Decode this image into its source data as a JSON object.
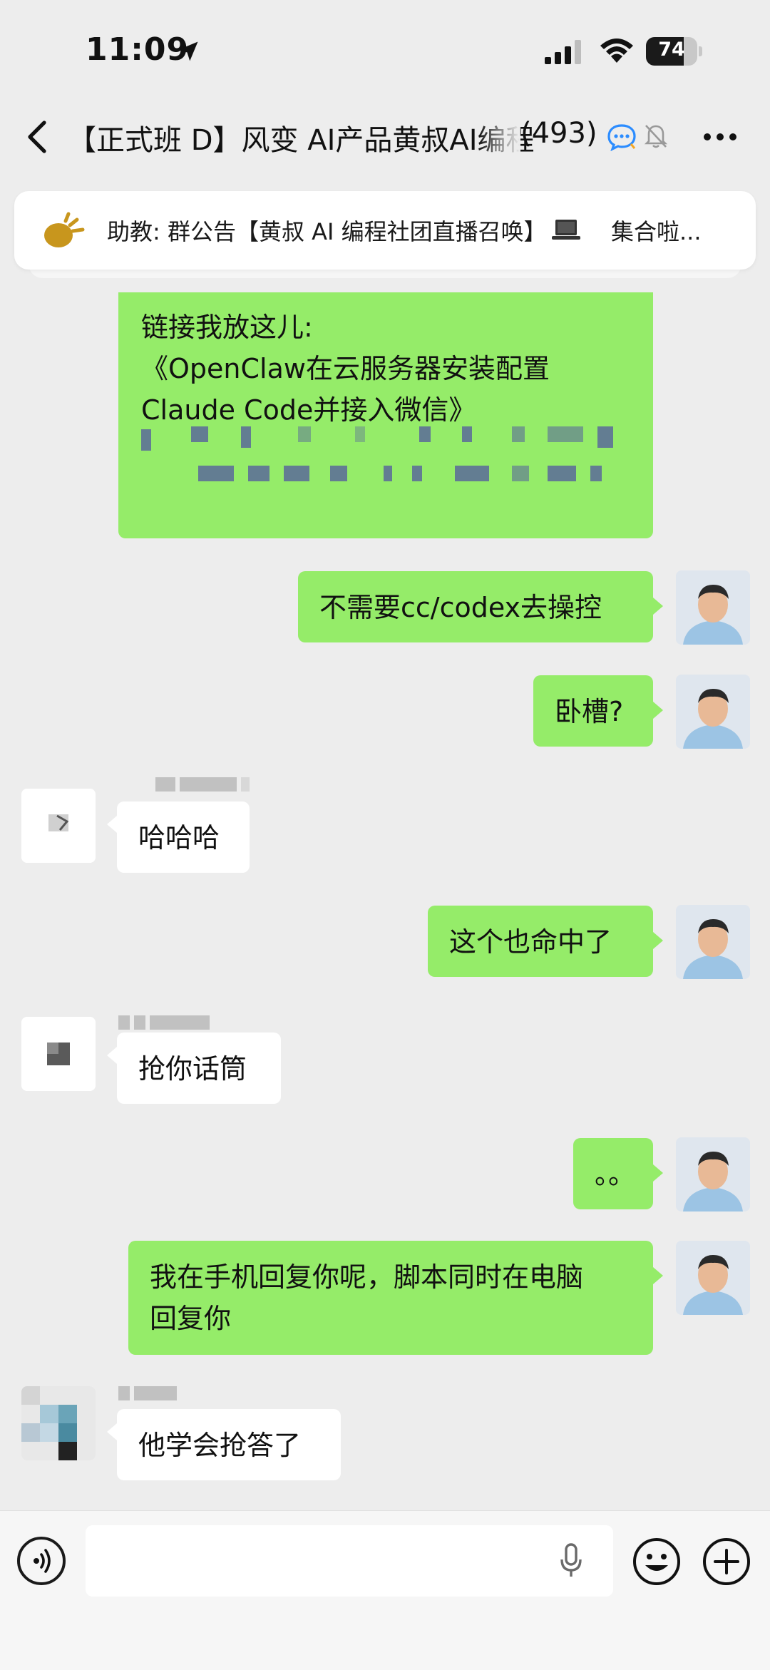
{
  "status_bar": {
    "time": "11:09",
    "battery_text": "74",
    "battery_level_percent": 74
  },
  "nav": {
    "title": "【正式班 D】风变 AI产品黄叔AI编程",
    "member_count": "(493)"
  },
  "announcement": {
    "prefix": "助教: 群公告【黄叔 AI 编程社团直播召唤】",
    "suffix": "集合啦..."
  },
  "messages": [
    {
      "sender": "me",
      "lines": [
        "链接我放这儿:",
        "《OpenClaw在云服务器安装配置",
        "Claude Code并接入微信》"
      ]
    },
    {
      "sender": "me",
      "text": "不需要cc/codex去操控"
    },
    {
      "sender": "me",
      "text": "卧槽?"
    },
    {
      "sender": "other",
      "text": "哈哈哈"
    },
    {
      "sender": "me",
      "text": "这个也命中了"
    },
    {
      "sender": "other",
      "text": "抢你话筒"
    },
    {
      "sender": "me",
      "text": "。。"
    },
    {
      "sender": "me",
      "lines": [
        "我在手机回复你呢，脚本同时在电脑",
        "回复你"
      ]
    },
    {
      "sender": "other",
      "text": "他学会抢答了"
    }
  ],
  "input_bar": {
    "placeholder": ""
  },
  "icons": {
    "location": "location-arrow-icon",
    "signal": "cellular-signal-icon",
    "wifi": "wifi-icon",
    "back": "back-chevron-icon",
    "chat_ai": "chat-ai-icon",
    "mute": "mute-bell-icon",
    "more": "more-dots-icon",
    "horn": "horn-icon",
    "laptop": "laptop-icon",
    "voice": "voice-icon",
    "mic": "mic-icon",
    "emoji": "emoji-icon",
    "plus": "plus-icon"
  },
  "colors": {
    "me_bubble": "#95ec69",
    "other_bubble": "#ffffff",
    "background": "#ededed"
  }
}
